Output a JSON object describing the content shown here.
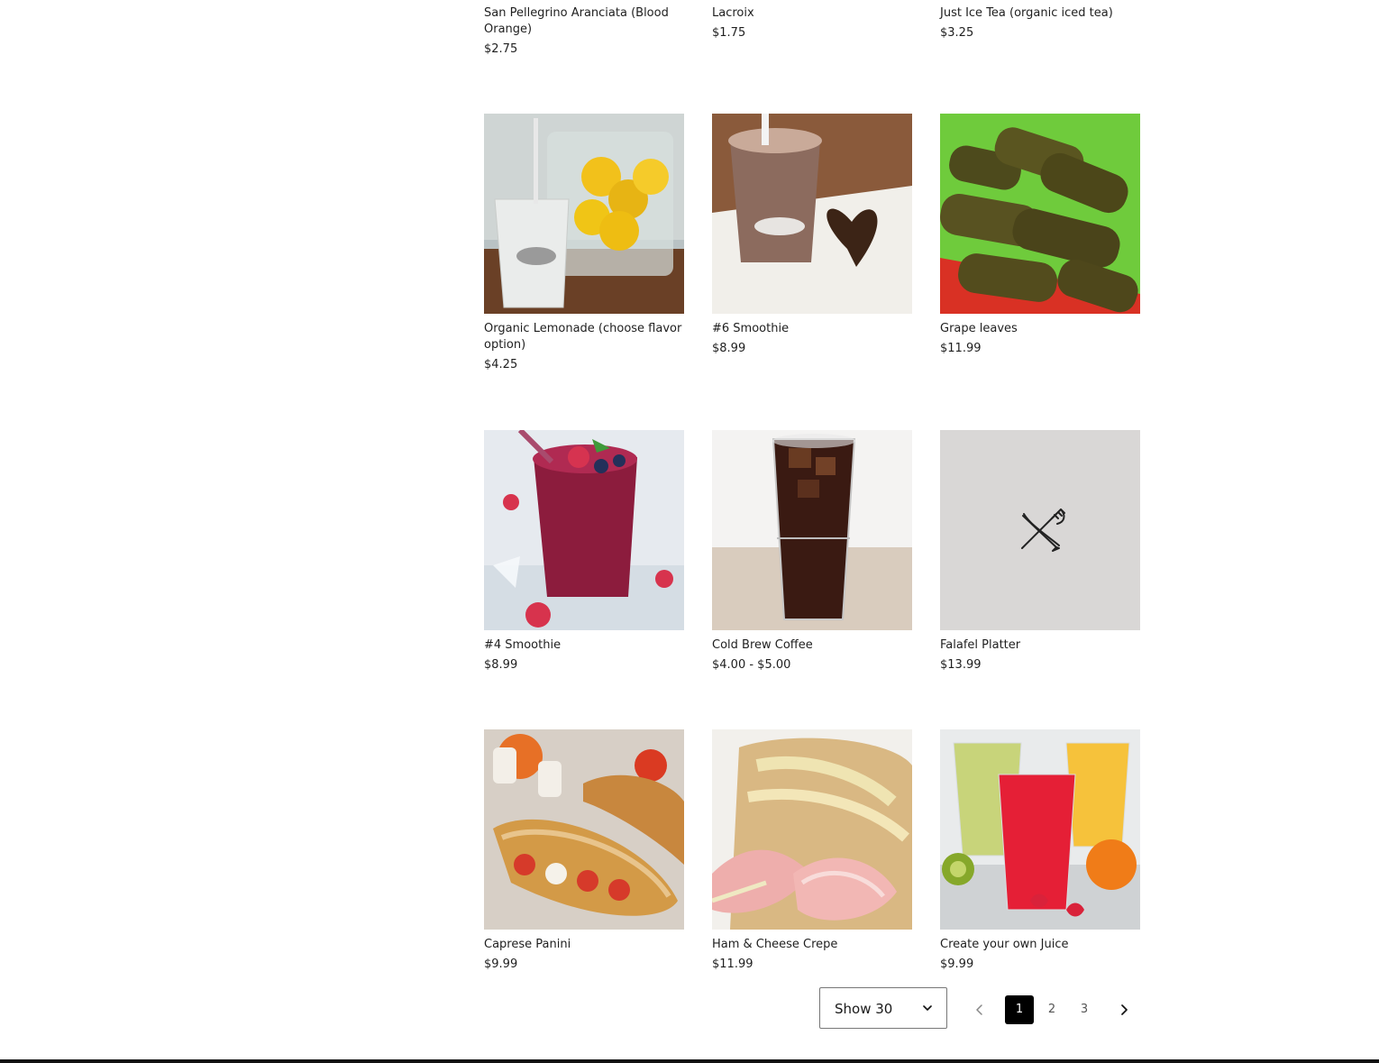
{
  "products": [
    {
      "name": "San Pellegrino Aranciata (Blood Orange)",
      "price": "$2.75"
    },
    {
      "name": "Lacroix",
      "price": "$1.75"
    },
    {
      "name": "Just Ice Tea (organic iced tea)",
      "price": "$3.25"
    },
    {
      "name": "Organic Lemonade (choose flavor option)",
      "price": "$4.25"
    },
    {
      "name": "#6 Smoothie",
      "price": "$8.99"
    },
    {
      "name": "Grape leaves",
      "price": "$11.99"
    },
    {
      "name": "#4 Smoothie",
      "price": "$8.99"
    },
    {
      "name": "Cold Brew Coffee",
      "price": "$4.00 - $5.00"
    },
    {
      "name": "Falafel Platter",
      "price": "$13.99"
    },
    {
      "name": "Caprese Panini",
      "price": "$9.99"
    },
    {
      "name": "Ham & Cheese Crepe",
      "price": "$11.99"
    },
    {
      "name": "Create your own Juice",
      "price": "$9.99"
    }
  ],
  "pagination": {
    "show_label": "Show 30",
    "pages": [
      "1",
      "2",
      "3"
    ],
    "current": "1"
  },
  "icons": {
    "placeholder": "fork-knife-icon",
    "prev": "chevron-left-icon",
    "next": "chevron-right-icon",
    "dropdown": "chevron-down-icon"
  }
}
